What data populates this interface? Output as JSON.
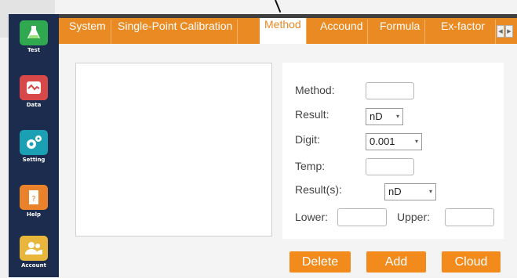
{
  "sidebar": {
    "items": [
      {
        "label": "Test",
        "icon": "flask-icon",
        "color": "#2fa84f"
      },
      {
        "label": "Data",
        "icon": "chart-icon",
        "color": "#d94848"
      },
      {
        "label": "Setting",
        "icon": "gears-icon",
        "color": "#1a9fb3"
      },
      {
        "label": "Help",
        "icon": "help-door-icon",
        "color": "#e9822a"
      },
      {
        "label": "Account",
        "icon": "users-icon",
        "color": "#e7b63b"
      }
    ]
  },
  "tabs": {
    "items": [
      "System",
      "Single-Point Calibration",
      "Method",
      "Accound",
      "Formula",
      "Ex-factor"
    ],
    "active": "Method",
    "scroll_left": "◀",
    "scroll_right": "▶"
  },
  "form": {
    "method_label": "Method:",
    "method_value": "",
    "result_label": "Result:",
    "result_value": "nD",
    "digit_label": "Digit:",
    "digit_value": "0.001",
    "temp_label": "Temp:",
    "temp_value": "",
    "results_label": "Result(s):",
    "results_value": "nD",
    "lower_label": "Lower:",
    "lower_value": "",
    "upper_label": "Upper:",
    "upper_value": ""
  },
  "buttons": {
    "delete": "Delete",
    "add": "Add",
    "cloud": "Cloud"
  },
  "colors": {
    "accent": "#e98a22",
    "sidebar": "#1c2c4e"
  }
}
